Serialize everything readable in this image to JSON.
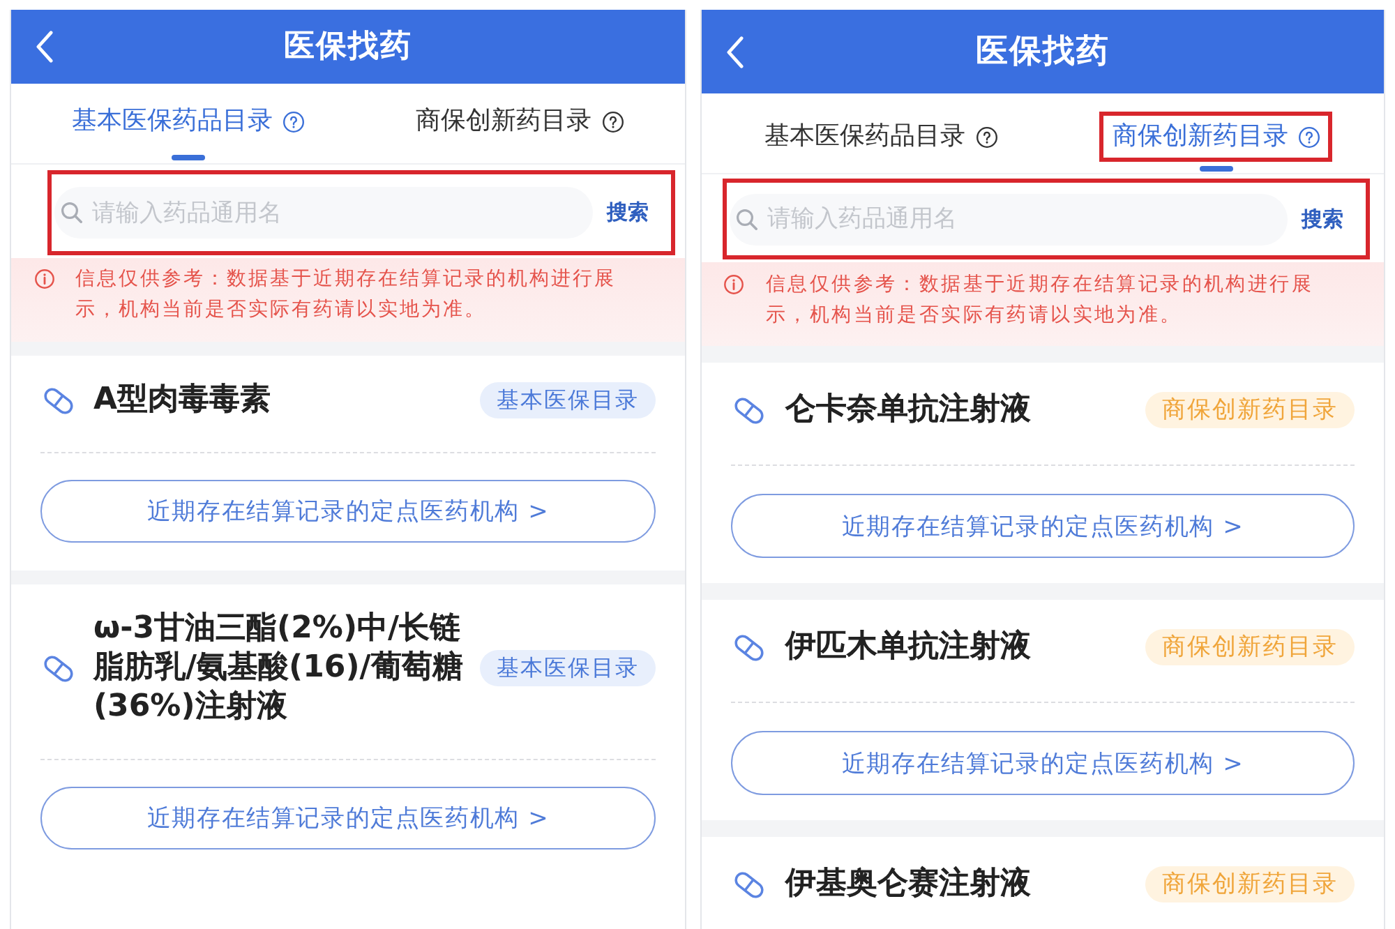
{
  "screens": [
    {
      "header": {
        "title": "医保找药"
      },
      "tabs": [
        {
          "label": "基本医保药品目录",
          "selected": true,
          "highlighted": false
        },
        {
          "label": "商保创新药目录",
          "selected": false,
          "highlighted": false
        }
      ],
      "search": {
        "placeholder": "请输入药品通用名",
        "button": "搜索",
        "highlighted": true
      },
      "notice": "信息仅供参考：数据基于近期存在结算记录的机构进行展示，机构当前是否实际有药请以实地为准。",
      "drugs": [
        {
          "name": "A型肉毒毒素",
          "tag": {
            "text": "基本医保目录",
            "kind": "basic"
          },
          "link_button": "近期存在结算记录的定点医药机构 >"
        },
        {
          "name": "ω-3甘油三酯(2%)中/长链脂肪乳/氨基酸(16)/葡萄糖(36%)注射液",
          "tag": {
            "text": "基本医保目录",
            "kind": "basic"
          },
          "link_button": "近期存在结算记录的定点医药机构 >"
        }
      ]
    },
    {
      "header": {
        "title": "医保找药"
      },
      "tabs": [
        {
          "label": "基本医保药品目录",
          "selected": false,
          "highlighted": false
        },
        {
          "label": "商保创新药目录",
          "selected": true,
          "highlighted": true
        }
      ],
      "search": {
        "placeholder": "请输入药品通用名",
        "button": "搜索",
        "highlighted": true
      },
      "notice": "信息仅供参考：数据基于近期存在结算记录的机构进行展示，机构当前是否实际有药请以实地为准。",
      "drugs": [
        {
          "name": "仑卡奈单抗注射液",
          "tag": {
            "text": "商保创新药目录",
            "kind": "commercial"
          },
          "link_button": "近期存在结算记录的定点医药机构 >"
        },
        {
          "name": "伊匹木单抗注射液",
          "tag": {
            "text": "商保创新药目录",
            "kind": "commercial"
          },
          "link_button": "近期存在结算记录的定点医药机构 >"
        },
        {
          "name": "伊基奥仑赛注射液",
          "tag": {
            "text": "商保创新药目录",
            "kind": "commercial"
          }
        }
      ]
    }
  ]
}
